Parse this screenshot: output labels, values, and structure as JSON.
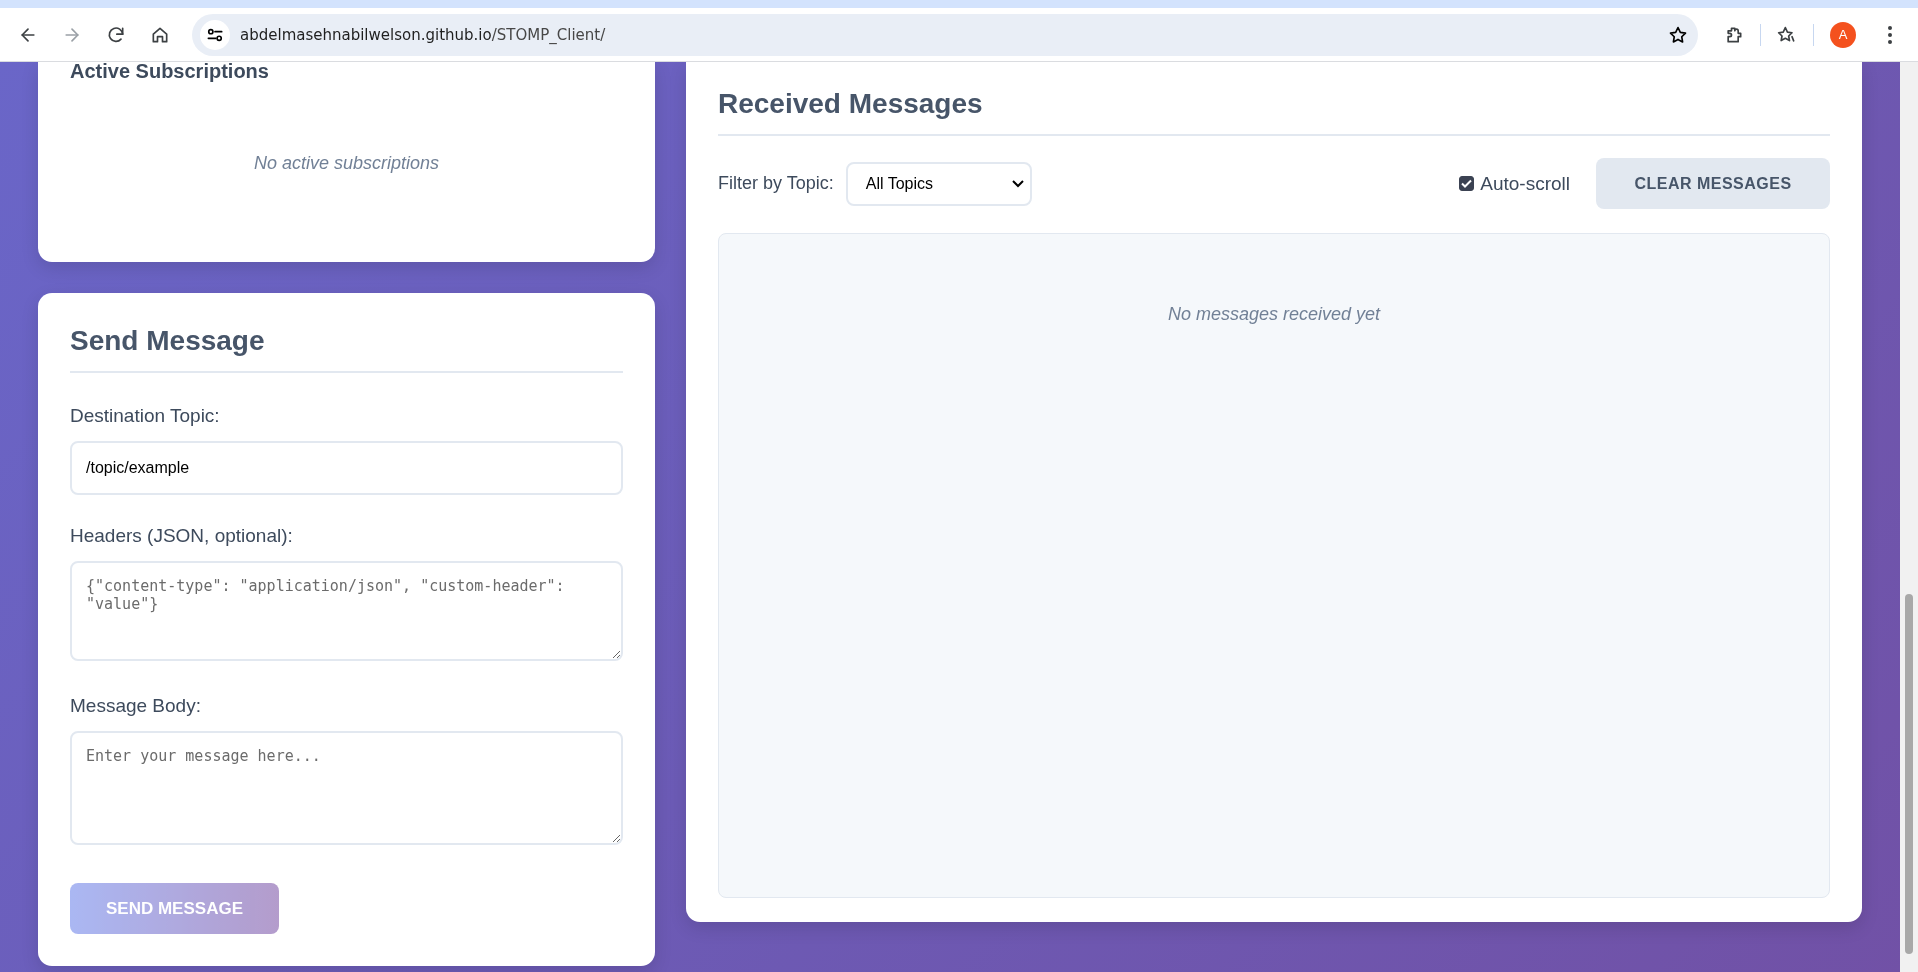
{
  "browser": {
    "url_host": "abdelmasehnabilwelson.github.io",
    "url_path": "/STOMP_Client/",
    "profile_initial": "A"
  },
  "subscriptions": {
    "title": "Active Subscriptions",
    "empty_text": "No active subscriptions"
  },
  "send": {
    "title": "Send Message",
    "fields": [
      {
        "kind": "input",
        "label": "Destination Topic:",
        "value": "/topic/example"
      },
      {
        "kind": "textarea",
        "label": "Headers (JSON, optional):",
        "placeholder": "{\"content-type\": \"application/json\", \"custom-header\": \"value\"}"
      },
      {
        "kind": "textarea",
        "label": "Message Body:",
        "placeholder": "Enter your message here..."
      }
    ],
    "button": {
      "label": "SEND MESSAGE",
      "disabled": true
    }
  },
  "received": {
    "title": "Received Messages",
    "filter_label": "Filter by Topic:",
    "filter_value": "All Topics",
    "autoscroll": {
      "label": "Auto-scroll",
      "checked": true
    },
    "clear_button": "CLEAR MESSAGES",
    "empty_text": "No messages received yet"
  }
}
